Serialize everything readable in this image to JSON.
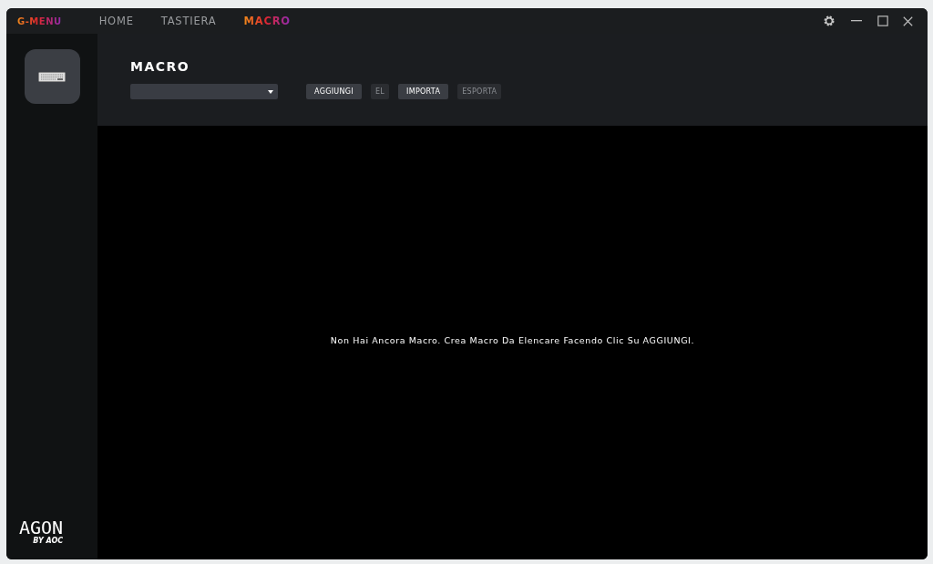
{
  "app": {
    "logo": "G-MENU"
  },
  "tabs": [
    {
      "label": "HOME",
      "selected": false
    },
    {
      "label": "TASTIERA",
      "selected": false
    },
    {
      "label": "MACRO",
      "selected": true
    }
  ],
  "sidebar": {
    "items": [
      {
        "kind": "keyboard",
        "selected": true
      }
    ],
    "brand": "AGON",
    "brand_sub": "BY AOC"
  },
  "header": {
    "title": "MACRO",
    "buttons": [
      {
        "label": "AGGIUNGI",
        "disabled": false
      },
      {
        "label": "EL",
        "disabled": true
      },
      {
        "label": "IMPORTA",
        "disabled": false
      },
      {
        "label": "ESPORTA",
        "disabled": true
      }
    ]
  },
  "empty_message": "Non Hai Ancora Macro. Crea Macro Da Elencare Facendo Clic Su AGGIUNGI."
}
